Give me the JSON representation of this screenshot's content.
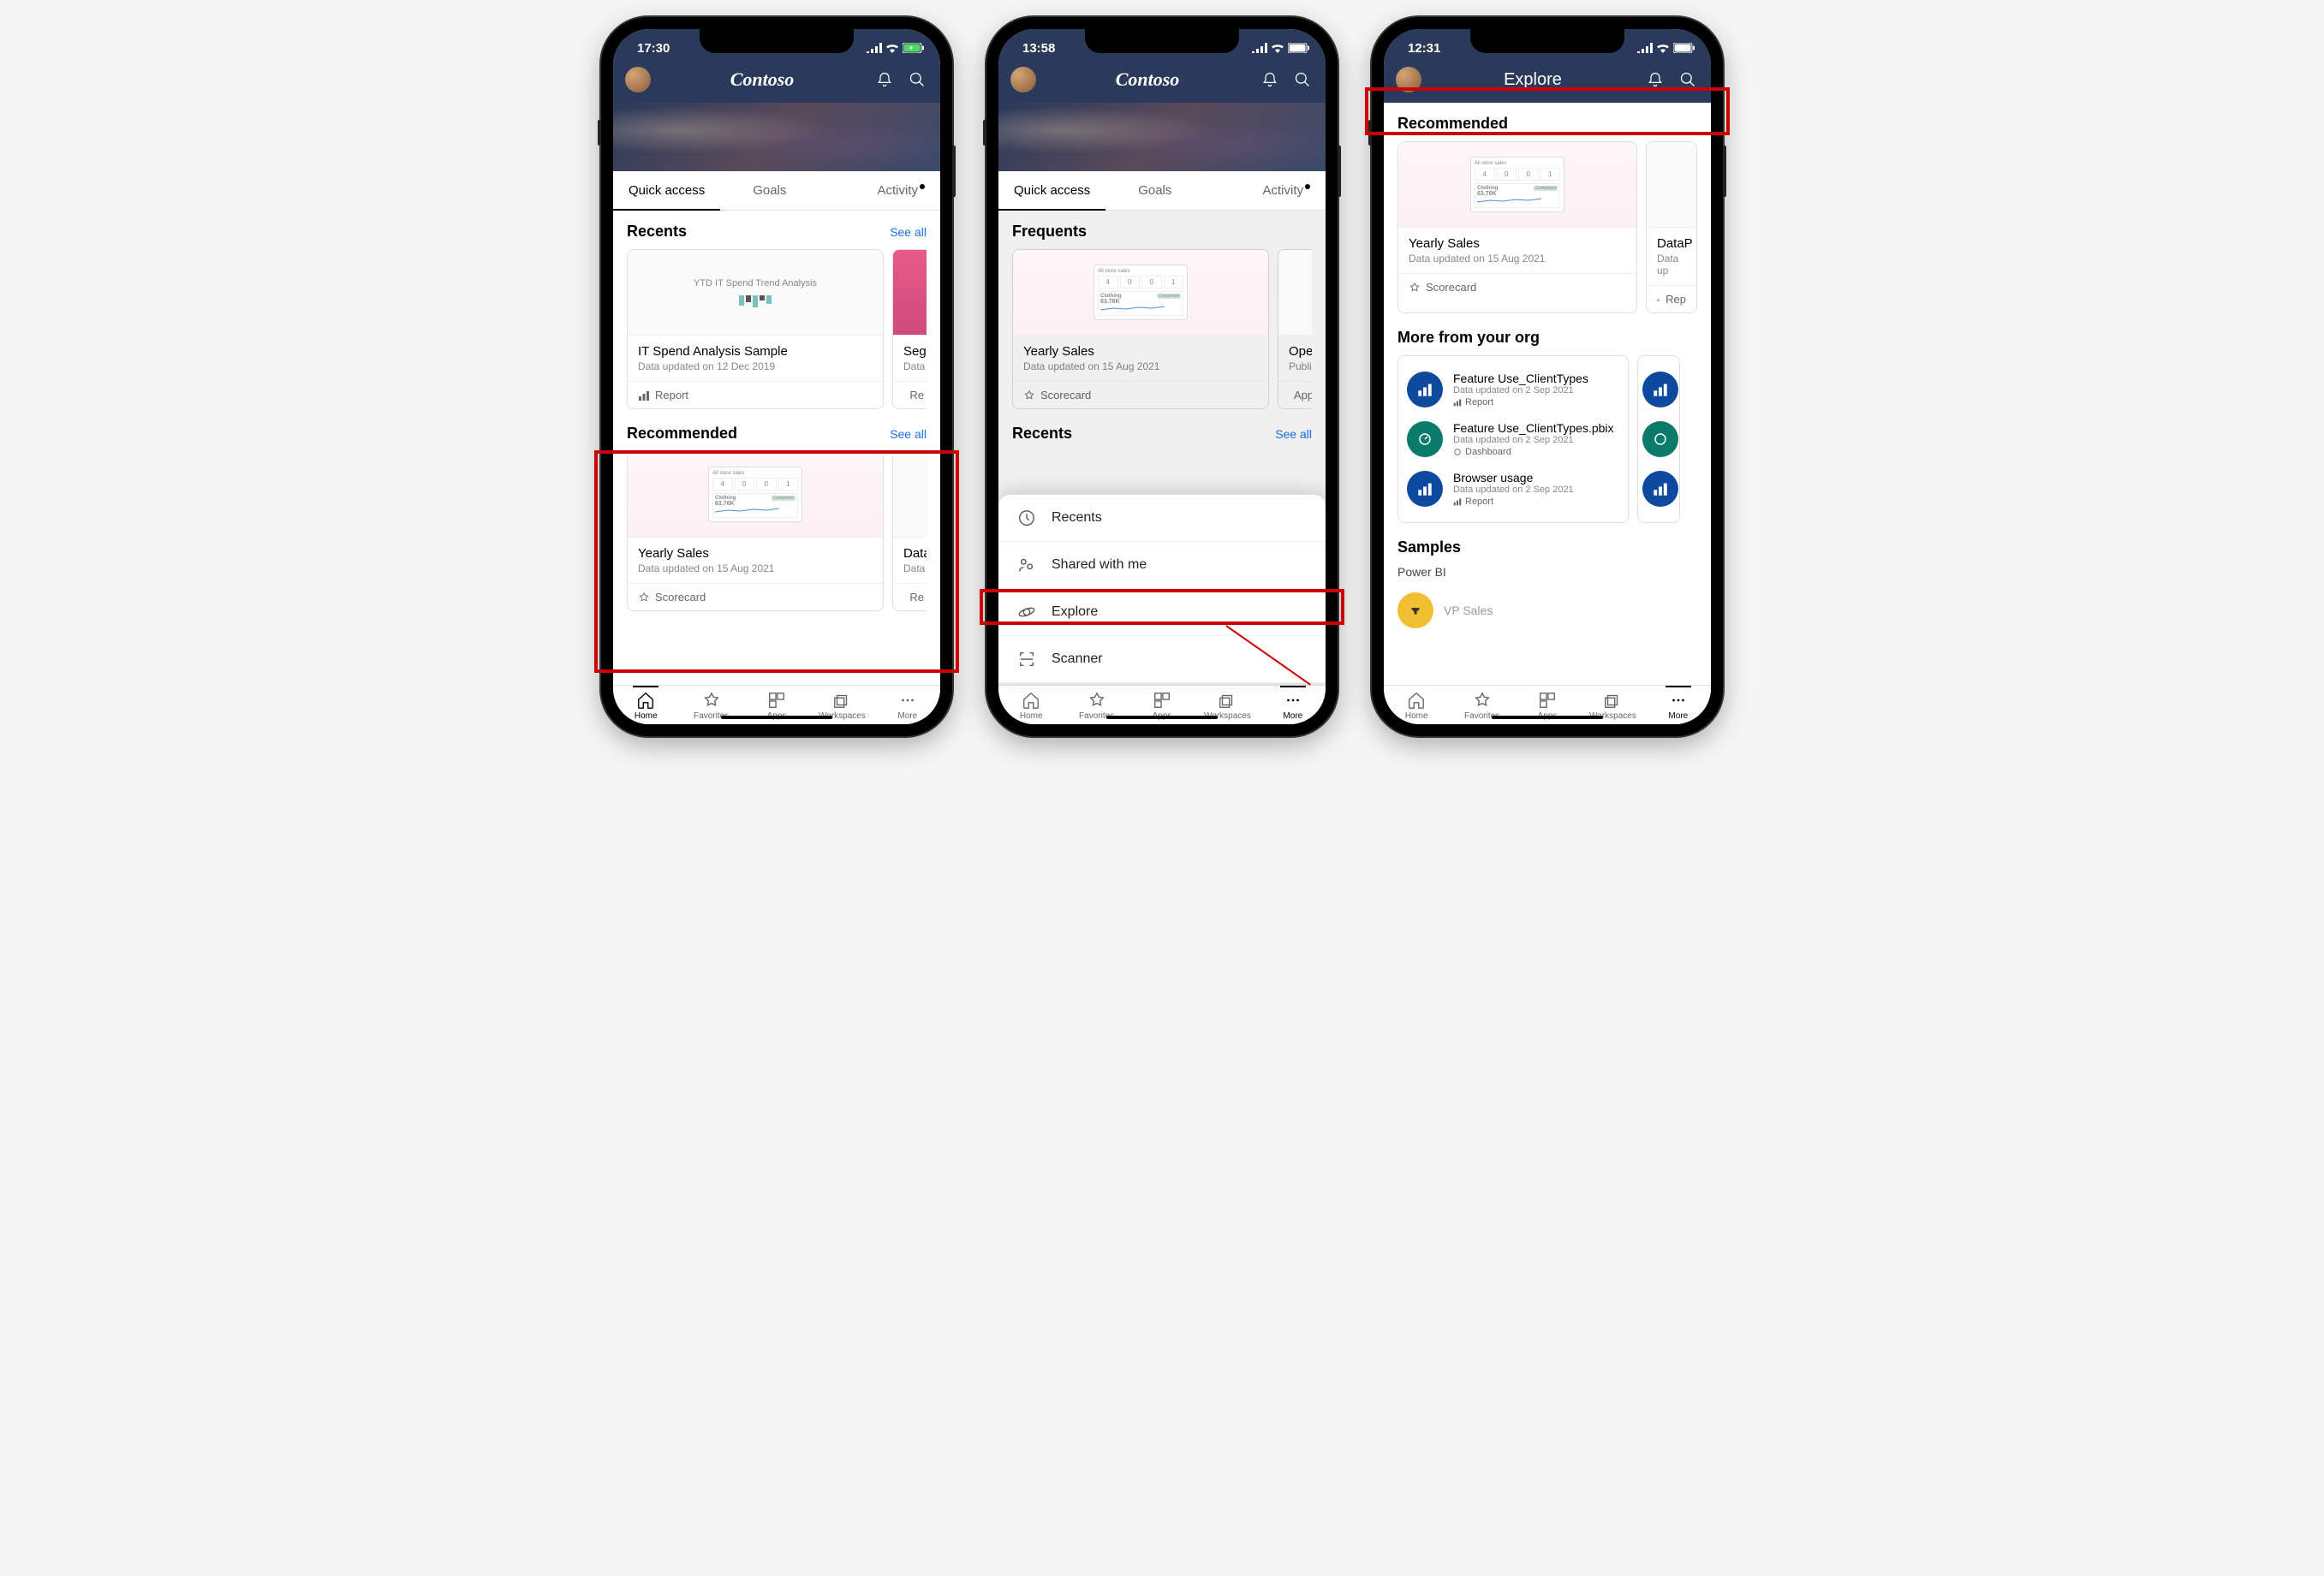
{
  "phones": [
    {
      "time": "17:30",
      "title": "Contoso",
      "tabs": [
        "Quick access",
        "Goals",
        "Activity"
      ],
      "activeTab": 0,
      "sections": {
        "recents": {
          "title": "Recents",
          "seeAll": "See all",
          "cards": [
            {
              "title": "IT Spend Analysis Sample",
              "sub": "Data updated on 12 Dec 2019",
              "type": "Report",
              "thumbText": "YTD IT Spend Trend Analysis"
            },
            {
              "title": "Seg",
              "sub": "Data",
              "type": "Re"
            }
          ]
        },
        "recommended": {
          "title": "Recommended",
          "seeAll": "See all",
          "cards": [
            {
              "title": "Yearly Sales",
              "sub": "Data updated on 15 Aug 2021",
              "type": "Scorecard"
            },
            {
              "title": "Data",
              "sub": "Data",
              "type": "Re"
            }
          ]
        }
      },
      "nav": [
        "Home",
        "Favorites",
        "Apps",
        "Workspaces",
        "More"
      ],
      "activeNav": 0
    },
    {
      "time": "13:58",
      "title": "Contoso",
      "tabs": [
        "Quick access",
        "Goals",
        "Activity"
      ],
      "activeTab": 0,
      "sections": {
        "frequents": {
          "title": "Frequents",
          "cards": [
            {
              "title": "Yearly Sales",
              "sub": "Data updated on 15 Aug 2021",
              "type": "Scorecard"
            },
            {
              "title": "Opera",
              "sub": "Publish",
              "type": "App"
            }
          ]
        },
        "recents": {
          "title": "Recents",
          "seeAll": "See all"
        }
      },
      "sheet": [
        "Recents",
        "Shared with me",
        "Explore",
        "Scanner"
      ],
      "nav": [
        "Home",
        "Favorites",
        "Apps",
        "Workspaces",
        "More"
      ],
      "activeNav": 4
    },
    {
      "time": "12:31",
      "title": "Explore",
      "sections": {
        "recommended": {
          "title": "Recommended",
          "cards": [
            {
              "title": "Yearly Sales",
              "sub": "Data updated on 15 Aug 2021",
              "type": "Scorecard"
            },
            {
              "title": "DataP",
              "sub": "Data up",
              "type": "Rep"
            }
          ]
        },
        "org": {
          "title": "More from your org",
          "items": [
            {
              "title": "Feature Use_ClientTypes",
              "sub": "Data updated on 2 Sep 2021",
              "type": "Report",
              "color": "blue"
            },
            {
              "title": "Feature Use_ClientTypes.pbix",
              "sub": "Data updated on 2 Sep 2021",
              "type": "Dashboard",
              "color": "teal"
            },
            {
              "title": "Browser usage",
              "sub": "Data updated on 2 Sep 2021",
              "type": "Report",
              "color": "blue"
            }
          ]
        },
        "samples": {
          "title": "Samples",
          "sub": "Power BI",
          "item": "VP Sales"
        }
      },
      "nav": [
        "Home",
        "Favorites",
        "Apps",
        "Workspaces",
        "More"
      ],
      "activeNav": 4
    }
  ],
  "scorecardThumb": {
    "header": "All store sales",
    "cells": [
      "4",
      "0",
      "0",
      "1"
    ],
    "segment": "Clothing",
    "value": "63.76K",
    "status": "Completed"
  }
}
